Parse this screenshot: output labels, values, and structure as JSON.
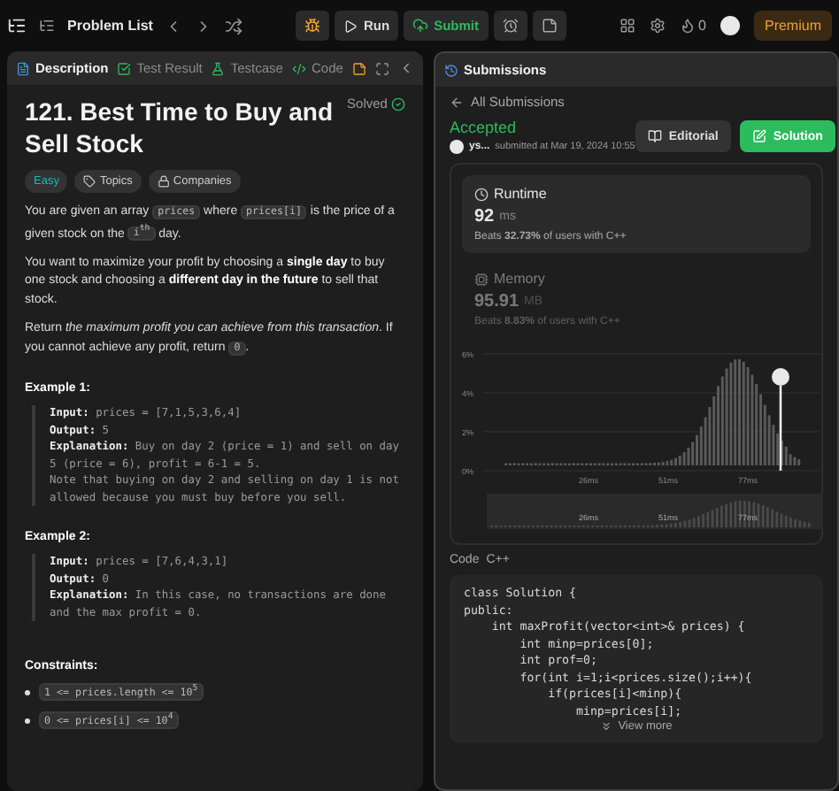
{
  "topbar": {
    "nav_label": "Problem List",
    "run_label": "Run",
    "submit_label": "Submit",
    "streak_count": "0",
    "premium_label": "Premium"
  },
  "left_tabs": [
    {
      "label": "Description",
      "selected": true
    },
    {
      "label": "Test Result",
      "selected": false
    },
    {
      "label": "Testcase",
      "selected": false
    },
    {
      "label": "Code",
      "selected": false
    }
  ],
  "problem": {
    "title": "121. Best Time to Buy and Sell Stock",
    "status": "Solved",
    "difficulty": "Easy",
    "tags": [
      "Topics",
      "Companies"
    ],
    "paragraphs": [
      [
        {
          "kind": "text",
          "text": "You are given an array "
        },
        {
          "kind": "code",
          "text": "prices"
        },
        {
          "kind": "text",
          "text": " where "
        },
        {
          "kind": "code",
          "text": "prices[i]"
        },
        {
          "kind": "text",
          "text": " is the price of a given stock on the "
        },
        {
          "kind": "code",
          "text": "i$^{th}$"
        },
        {
          "kind": "text",
          "text": " day."
        }
      ],
      [
        {
          "kind": "text",
          "text": "You want to maximize your profit by choosing a **single day** to buy one stock and choosing a **different day in the future** to sell that stock."
        }
      ],
      [
        {
          "kind": "text",
          "text": "Return *the maximum profit you can achieve from this transaction*. If you cannot achieve any profit, return "
        },
        {
          "kind": "code",
          "text": "0"
        },
        {
          "kind": "text",
          "text": "."
        }
      ]
    ],
    "examples": [
      {
        "title": "Example 1:",
        "body": "**Input:** prices = [7,1,5,3,6,4]\n**Output:** 5\n**Explanation:** Buy on day 2 (price = 1) and sell on day 5 (price = 6), profit = 6-1 = 5.\nNote that buying on day 2 and selling on day 1 is not allowed because you must buy before you sell."
      },
      {
        "title": "Example 2:",
        "body": "**Input:** prices = [7,6,4,3,1]\n**Output:** 0\n**Explanation:** In this case, no transactions are done and the max profit = 0."
      }
    ],
    "constraints_title": "Constraints:",
    "constraints": [
      "1 <= prices.length <= 10$^{5}$",
      "0 <= prices[i] <= 10$^{4}$"
    ]
  },
  "right_panel": {
    "tab_label": "Submissions",
    "back_label": "All Submissions",
    "verdict": "Accepted",
    "user": "ys...",
    "submitted": "submitted at Mar 19, 2024 10:55",
    "editorial_label": "Editorial",
    "solution_label": "Solution",
    "stats": [
      {
        "title": "Runtime",
        "value": "92",
        "unit": "ms",
        "beats": "Beats **32.73%** of users with C++",
        "selected": true
      },
      {
        "title": "Memory",
        "value": "95.91",
        "unit": "MB",
        "beats": "Beats **8.83%** of users with C++",
        "selected": false
      }
    ],
    "chart": {
      "y_labels": [
        "6%",
        "4%",
        "2%",
        "0%"
      ],
      "x_labels": [
        "26ms",
        "51ms",
        "77ms"
      ],
      "mini_labels": [
        "26ms",
        "51ms",
        "77ms"
      ]
    },
    "code_label": "Code",
    "language": "C++",
    "code_lines": [
      "class Solution {",
      "public:",
      "    int maxProfit(vector<int>& prices) {",
      "        int minp=prices[0];",
      "        int prof=0;",
      "        for(int i=1;i<prices.size();i++){",
      "            if(prices[i]<minp){",
      "                minp=prices[i];"
    ],
    "view_more": "View more"
  }
}
